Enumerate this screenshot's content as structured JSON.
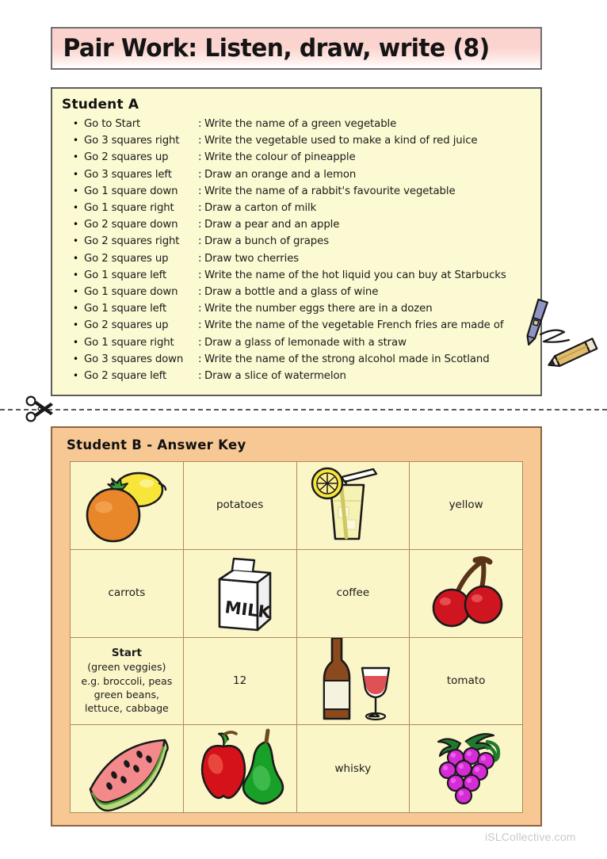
{
  "header": {
    "title": "Pair Work: Listen, draw, write (8)"
  },
  "student_a": {
    "title": "Student A",
    "instructions": [
      {
        "move": "Go to Start",
        "task": "Write the name of a green vegetable"
      },
      {
        "move": "Go 3 squares right",
        "task": "Write the vegetable used to make a kind of red juice"
      },
      {
        "move": "Go 2 squares up",
        "task": "Write the colour of pineapple"
      },
      {
        "move": "Go 3 squares left",
        "task": "Draw an orange and a lemon"
      },
      {
        "move": "Go 1 square down",
        "task": "Write the name of a rabbit's favourite vegetable"
      },
      {
        "move": "Go 1 square right",
        "task": "Draw a carton of milk"
      },
      {
        "move": "Go 2 square down",
        "task": "Draw a pear and an apple"
      },
      {
        "move": "Go 2 squares right",
        "task": "Draw a bunch of grapes"
      },
      {
        "move": "Go 2 squares up",
        "task": "Draw two cherries"
      },
      {
        "move": "Go 1 square left",
        "task": "Write the name of the hot liquid you can buy at Starbucks"
      },
      {
        "move": "Go 1 square down",
        "task": "Draw a bottle and a glass of wine"
      },
      {
        "move": "Go 1 square left",
        "task": "Write the number eggs there are in a dozen"
      },
      {
        "move": "Go 2 squares up",
        "task": "Write the name of the vegetable French fries are made of"
      },
      {
        "move": "Go 1 square right",
        "task": "Draw a glass of lemonade with a straw"
      },
      {
        "move": "Go 3 squares down",
        "task": "Write the name of the strong alcohol made in Scotland"
      },
      {
        "move": "Go 2 square left",
        "task": "Draw a slice of watermelon"
      }
    ],
    "colon": ":",
    "doodle_icon": "pen-and-pencil-icon"
  },
  "cut_line": {
    "icon": "scissors-icon"
  },
  "student_b": {
    "title": "Student B - Answer Key",
    "grid": [
      [
        {
          "type": "image",
          "icon": "orange-and-lemon-icon",
          "text": ""
        },
        {
          "type": "text",
          "icon": "",
          "text": "potatoes"
        },
        {
          "type": "image",
          "icon": "lemonade-glass-with-straw-icon",
          "text": ""
        },
        {
          "type": "text",
          "icon": "",
          "text": "yellow"
        }
      ],
      [
        {
          "type": "text",
          "icon": "",
          "text": "carrots"
        },
        {
          "type": "image",
          "icon": "milk-carton-icon",
          "text": "MILK"
        },
        {
          "type": "text",
          "icon": "",
          "text": "coffee"
        },
        {
          "type": "image",
          "icon": "two-cherries-icon",
          "text": ""
        }
      ],
      [
        {
          "type": "start",
          "icon": "",
          "start_word": "Start",
          "lines": [
            "(green veggies)",
            "e.g. broccoli, peas",
            "green beans,",
            "lettuce, cabbage"
          ]
        },
        {
          "type": "text",
          "icon": "",
          "text": "12"
        },
        {
          "type": "image",
          "icon": "wine-bottle-and-glass-icon",
          "text": ""
        },
        {
          "type": "text",
          "icon": "",
          "text": "tomato"
        }
      ],
      [
        {
          "type": "image",
          "icon": "watermelon-slice-icon",
          "text": ""
        },
        {
          "type": "image",
          "icon": "apple-and-pear-icon",
          "text": ""
        },
        {
          "type": "text",
          "icon": "",
          "text": "whisky"
        },
        {
          "type": "image",
          "icon": "bunch-of-grapes-icon",
          "text": ""
        }
      ]
    ]
  },
  "footer": {
    "watermark": "iSLCollective.com"
  },
  "colors": {
    "title_banner": "#fbd2cd",
    "panel_a_bg": "#fcfad2",
    "panel_b_bg": "#f7c894",
    "cell_bg": "#fbf6c8",
    "grid_line": "#b08a5a",
    "orange": "#e8872a",
    "lemon": "#f5e53c",
    "cherry_red": "#d1151c",
    "grape_purple": "#d62bd6",
    "pear_green": "#10a028",
    "wine_red": "#d94a4a",
    "watermelon_pink": "#f4898b"
  }
}
